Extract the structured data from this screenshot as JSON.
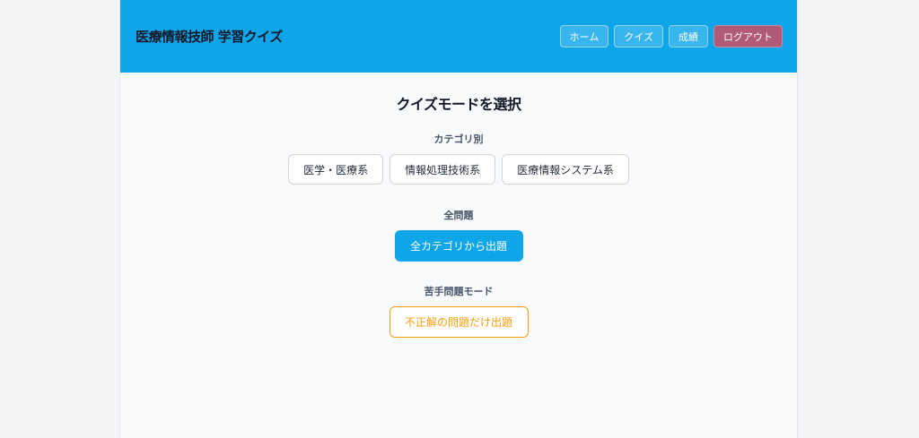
{
  "header": {
    "title": "医療情報技師 学習クイズ",
    "nav": [
      {
        "label": "ホーム"
      },
      {
        "label": "クイズ"
      },
      {
        "label": "成績"
      },
      {
        "label": "ログアウト"
      }
    ]
  },
  "main": {
    "heading": "クイズモードを選択",
    "category_section": {
      "label": "カテゴリ別",
      "buttons": [
        {
          "label": "医学・医療系"
        },
        {
          "label": "情報処理技術系"
        },
        {
          "label": "医療情報システム系"
        }
      ]
    },
    "all_section": {
      "label": "全問題",
      "button": "全カテゴリから出題"
    },
    "weak_section": {
      "label": "苦手問題モード",
      "button": "不正解の問題だけ出題"
    }
  },
  "colors": {
    "header_bg": "#0ea5e9",
    "primary": "#0ea5e9",
    "logout": "#b05a78",
    "weak_accent": "#f59e0b"
  }
}
